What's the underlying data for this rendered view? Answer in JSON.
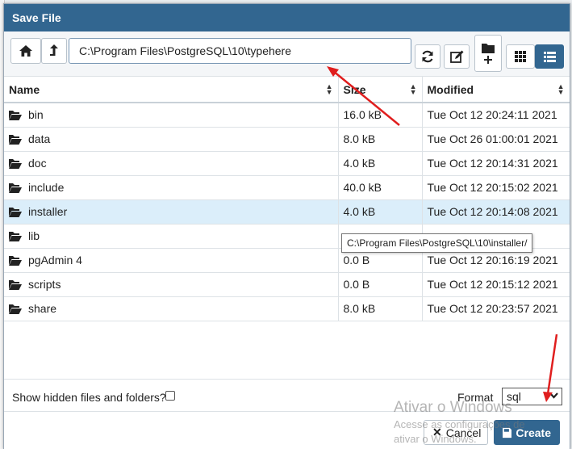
{
  "dialog": {
    "title": "Save File"
  },
  "toolbar": {
    "path_value": "C:\\Program Files\\PostgreSQL\\10\\typehere",
    "home_icon": "home-icon",
    "up_icon": "up-arrow-icon",
    "refresh_icon": "refresh-icon",
    "edit_icon": "edit-icon",
    "new_folder_icon": "new-folder-icon",
    "grid_view_icon": "grid-view-icon",
    "list_view_icon": "list-view-icon"
  },
  "table": {
    "headers": {
      "name": "Name",
      "size": "Size",
      "modified": "Modified"
    },
    "rows": [
      {
        "name": "bin",
        "size": "16.0 kB",
        "modified": "Tue Oct 12 20:24:11 2021"
      },
      {
        "name": "data",
        "size": "8.0 kB",
        "modified": "Tue Oct 26 01:00:01 2021"
      },
      {
        "name": "doc",
        "size": "4.0 kB",
        "modified": "Tue Oct 12 20:14:31 2021"
      },
      {
        "name": "include",
        "size": "40.0 kB",
        "modified": "Tue Oct 12 20:15:02 2021"
      },
      {
        "name": "installer",
        "size": "4.0 kB",
        "modified": "Tue Oct 12 20:14:08 2021",
        "selected": true
      },
      {
        "name": "lib",
        "size": "",
        "modified": ""
      },
      {
        "name": "pgAdmin 4",
        "size": "0.0 B",
        "modified": "Tue Oct 12 20:16:19 2021"
      },
      {
        "name": "scripts",
        "size": "0.0 B",
        "modified": "Tue Oct 12 20:15:12 2021"
      },
      {
        "name": "share",
        "size": "8.0 kB",
        "modified": "Tue Oct 12 20:23:57 2021"
      }
    ]
  },
  "tooltip": "C:\\Program Files\\PostgreSQL\\10\\installer/",
  "options": {
    "show_hidden_label": "Show hidden files and folders?",
    "format_label": "Format",
    "format_value": "sql"
  },
  "footer": {
    "cancel_label": "Cancel",
    "create_label": "Create"
  },
  "watermark": {
    "title": "Ativar o Windows",
    "line1": "Acesse as configurações de",
    "line2": "ativar o Windows."
  },
  "colors": {
    "accent": "#326690",
    "selected_row": "#dbeefa",
    "annotation": "#e01e1e"
  }
}
